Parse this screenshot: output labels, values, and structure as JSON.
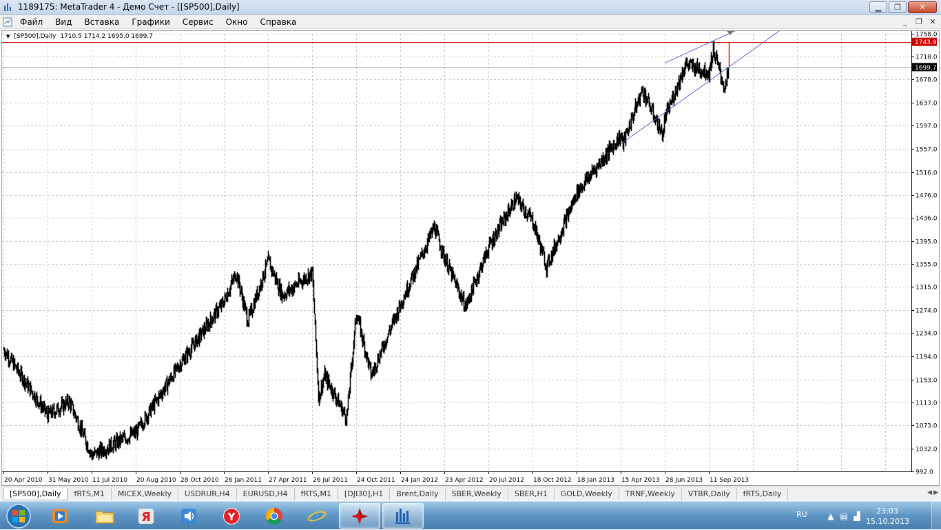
{
  "window": {
    "title": "1189175: MetaTrader 4 - Демо Счет - [[SP500],Daily]",
    "minimize_label": "▁",
    "restore_label": "❐",
    "close_label": "✕"
  },
  "menu": {
    "items": [
      "Файл",
      "Вид",
      "Вставка",
      "Графики",
      "Сервис",
      "Окно",
      "Справка"
    ],
    "mdi_minimize": "_",
    "mdi_restore": "❐",
    "mdi_close": "✕"
  },
  "chart": {
    "header_symbol": "[SP500],Daily",
    "header_ohlc": "1710.5 1714.2 1695.0 1699.7",
    "current_price_label": "1699.7",
    "alert_line_label": "1743.9",
    "colors": {
      "grid": "#c8c8c8",
      "candles": "#000000",
      "channel": "#6b5cc9",
      "alert_line": "#cc0000",
      "bid_line": "#8fa3c0",
      "last_bar": "#dd1111"
    }
  },
  "chart_data": {
    "type": "line",
    "title": "[SP500],Daily",
    "xlabel": "",
    "ylabel": "",
    "ylim": [
      992.0,
      1758.0
    ],
    "y_ticks": [
      1758.0,
      1718.0,
      1678.0,
      1637.0,
      1597.0,
      1557.0,
      1516.0,
      1476.0,
      1436.0,
      1395.0,
      1355.0,
      1315.0,
      1274.0,
      1234.0,
      1194.0,
      1153.0,
      1113.0,
      1073.0,
      1032.0,
      992.0
    ],
    "x_ticks": [
      "20 Apr 2010",
      "31 May 2010",
      "11 Jul 2010",
      "20 Aug 2010",
      "28 Oct 2010",
      "26 Jan 2011",
      "27 Apr 2011",
      "26 Jul 2011",
      "24 Oct 2011",
      "24 Jan 2012",
      "23 Apr 2012",
      "20 Jul 2012",
      "18 Oct 2012",
      "18 Jan 2013",
      "15 Apr 2013",
      "28 Jun 2013",
      "11 Sep 2013"
    ],
    "series": [
      {
        "x": [
          "20 Apr 2010",
          "31 May 2010",
          "20 Jun 2010",
          "11 Jul 2010",
          "20 Aug 2010",
          "28 Oct 2010",
          "26 Jan 2011",
          "20 Feb 2011",
          "16 Mar 2011",
          "27 Apr 2011",
          "26 May 2011",
          "26 Jul 2011",
          "08 Aug 2011",
          "20 Aug 2011",
          "04 Oct 2011",
          "24 Oct 2011",
          "24 Nov 2011",
          "24 Jan 2012",
          "02 Apr 2012",
          "23 Apr 2012",
          "04 Jun 2012",
          "20 Jul 2012",
          "14 Sep 2012",
          "18 Oct 2012",
          "16 Nov 2012",
          "18 Jan 2013",
          "15 Apr 2013",
          "18 Apr 2013",
          "21 May 2013",
          "24 Jun 2013",
          "28 Jun 2013",
          "02 Aug 2013",
          "11 Sep 2013",
          "18 Sep 2013",
          "08 Oct 2013",
          "15 Oct 2013"
        ],
        "y": [
          1205,
          1090,
          1115,
          1020,
          1060,
          1180,
          1290,
          1340,
          1255,
          1360,
          1300,
          1340,
          1120,
          1160,
          1085,
          1270,
          1160,
          1285,
          1420,
          1365,
          1280,
          1385,
          1470,
          1430,
          1350,
          1480,
          1580,
          1565,
          1660,
          1580,
          1610,
          1705,
          1690,
          1730,
          1660,
          1699.7
        ]
      }
    ],
    "alert_level": 1743.9,
    "last_price": 1699.7,
    "channel": {
      "upper": {
        "from": [
          "28 Jun 2013",
          1707
        ],
        "to": [
          "15 Oct 2013",
          1758
        ]
      },
      "lower": {
        "from": [
          "15 Apr 2013",
          1565
        ],
        "to": [
          "15 Oct 2013",
          1700
        ]
      }
    },
    "grid": true,
    "legend": "none"
  },
  "tabs": [
    "[SP500],Daily",
    "fRTS,M1",
    "MICEX,Weekly",
    "USDRUR,H4",
    "EURUSD,H4",
    "fRTS,M1",
    "[DJI30],H1",
    "Brent,Daily",
    "SBER,Weekly",
    "SBER,H1",
    "GOLD,Weekly",
    "TRNF,Weekly",
    "VTBR,Daily",
    "fRTS,Daily"
  ],
  "taskbar": {
    "icons": [
      "windows-start-icon",
      "media-player-icon",
      "folder-icon",
      "yandex-icon",
      "speaker-app-icon",
      "yandex-browser-icon",
      "chrome-icon",
      "internet-explorer-icon",
      "red-star-app-icon",
      "metatrader-icon"
    ],
    "language": "RU",
    "time": "23:03",
    "date": "15.10.2013"
  }
}
